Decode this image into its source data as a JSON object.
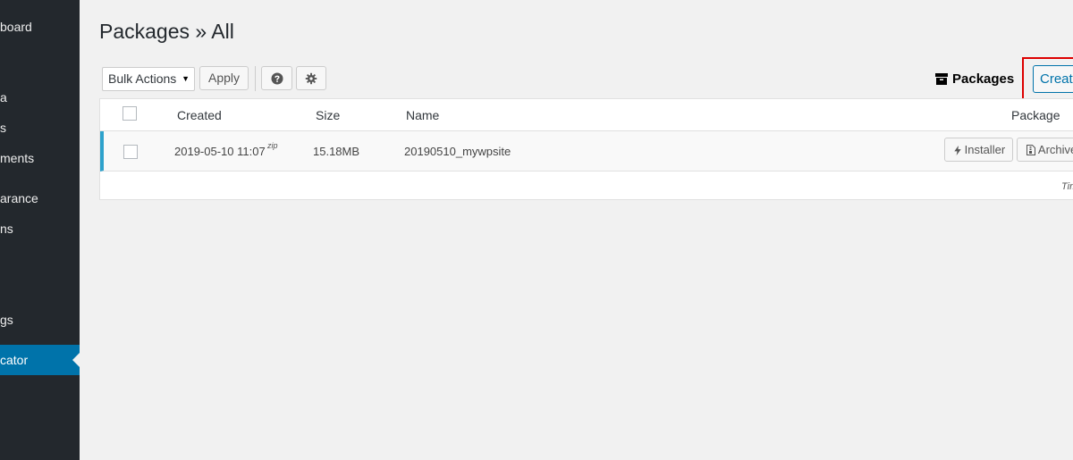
{
  "sidebar": {
    "items": [
      {
        "label": "board",
        "active": false
      },
      {
        "label": "a",
        "active": false
      },
      {
        "label": "s",
        "active": false
      },
      {
        "label": "ments",
        "active": false
      },
      {
        "label": "arance",
        "active": false
      },
      {
        "label": "ns",
        "active": false
      },
      {
        "label": "gs",
        "active": false
      },
      {
        "label": "cator",
        "active": true
      }
    ]
  },
  "header": {
    "title": "Packages » All"
  },
  "toolbar": {
    "bulk_actions": "Bulk Actions",
    "apply_label": "Apply",
    "packages_label": "Packages",
    "create_label": "Create New"
  },
  "table": {
    "columns": {
      "created": "Created",
      "size": "Size",
      "name": "Name",
      "package": "Package"
    },
    "rows": [
      {
        "created": "2019-05-10 11:07",
        "format": "zip",
        "size": "15.18MB",
        "name": "20190510_mywpsite",
        "installer_label": "Installer",
        "archive_label": "Archive"
      }
    ],
    "footer": "Time"
  },
  "colors": {
    "sidebar_bg": "#23282d",
    "active_menu": "#0073aa",
    "row_accent": "#2ea2cc",
    "highlight_outline": "#dd0000"
  }
}
